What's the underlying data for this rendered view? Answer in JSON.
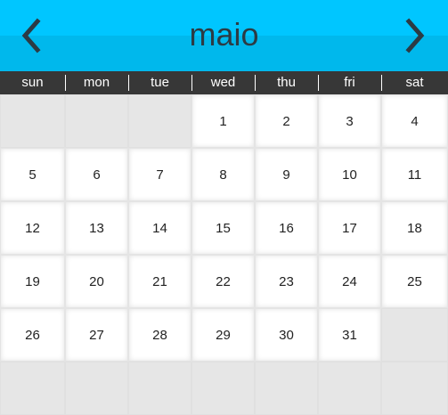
{
  "calendar": {
    "month": "maio",
    "prev_icon": "chevron-left-icon",
    "next_icon": "chevron-right-icon",
    "weekdays": [
      "sun",
      "mon",
      "tue",
      "wed",
      "thu",
      "fri",
      "sat"
    ],
    "first_weekday_index": 3,
    "days_in_month": 31,
    "rows": 6
  },
  "colors": {
    "header_top": "#00c6ff",
    "header_bottom": "#00b8ec",
    "title_text": "#2c3b44",
    "weekday_bar": "#373737",
    "day_cell": "#ffffff",
    "empty_cell": "#e6e6e6"
  }
}
